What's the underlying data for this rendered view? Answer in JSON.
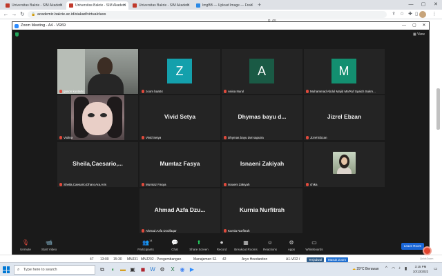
{
  "browser": {
    "tabs": [
      {
        "label": "Universitas Bakrie - SIM Akadem",
        "active": false,
        "favicon_color": "#c0392b"
      },
      {
        "label": "Universitas Bakrie - SIM Akadem",
        "active": true,
        "favicon_color": "#c0392b"
      },
      {
        "label": "Universitas Bakrie - SIM Akadem",
        "active": false,
        "favicon_color": "#c0392b"
      },
      {
        "label": "ImgBB — Upload Image — Free",
        "active": false,
        "favicon_color": "#2b8ae6"
      }
    ],
    "new_tab": "+",
    "url": "academic.bakrie.ac.id/siakad/virtualclass"
  },
  "zoom": {
    "title": "Zoom Meeting - A4 - VR69",
    "view_label": "View",
    "accent_color": "#2d8cff",
    "speaking_color": "#c7e54a",
    "tiles": [
      {
        "name": "guson kuntarto",
        "type": "video",
        "speaking": true
      },
      {
        "name": "zoom baa04",
        "type": "letter",
        "letter": "Z",
        "color": "#14a0ac"
      },
      {
        "name": "Anisa Nurul",
        "type": "letter",
        "letter": "A",
        "color": "#1a5a45"
      },
      {
        "name": "Muhammad Abdul Majid Ma'Ruf Syaich Sukm...",
        "type": "letter",
        "letter": "M",
        "color": "#138f70"
      },
      {
        "name": "Violina",
        "type": "avatar"
      },
      {
        "name": "Vivid Setya",
        "display": "Vivid Setya",
        "type": "name"
      },
      {
        "name": "Dhymas bayu dwi saputra",
        "display": "Dhymas bayu d...",
        "type": "name"
      },
      {
        "name": "Jizrel Ebzan",
        "display": "Jizrel Ebzan",
        "type": "name"
      },
      {
        "name": "Sheila,Caesario,Dhani,Ara,Aris",
        "display": "Sheila,Caesario,...",
        "type": "name"
      },
      {
        "name": "Mumtaz Fasya",
        "display": "Mumtaz Fasya",
        "type": "name"
      },
      {
        "name": "Isnaeni Zakiyah",
        "display": "Isnaeni Zakiyah",
        "type": "name"
      },
      {
        "name": "chika",
        "type": "photo"
      },
      {
        "name": "Ahmad Azfa Dzulfaqar",
        "display": "Ahmad Azfa Dzu...",
        "type": "name"
      },
      {
        "name": "Kurnia Nurfitrah",
        "display": "Kurnia Nurfitrah",
        "type": "name"
      }
    ],
    "controls": {
      "unmute": "Unmute",
      "start_video": "Start Video",
      "participants": "Participants",
      "participant_count": "14",
      "chat": "Chat",
      "share_screen": "Share Screen",
      "record": "Record",
      "breakout_rooms": "Breakout Rooms",
      "reactions": "Reactions",
      "apps": "Apps",
      "whiteboards": "Whiteboards",
      "leave": "Leave Room"
    }
  },
  "background_page": {
    "row": {
      "no": "47",
      "start": "13:00",
      "end": "15:30",
      "code": "MNJ31",
      "course_code": "MNJ202 - Pengembangan",
      "program": "Manajemen S1",
      "num": "42",
      "lecturer": "Aryo Hoedaniton",
      "room": "A1-VR2 /",
      "badge1": "Terjadwal",
      "badge2": "Masuk Zoom"
    },
    "corner_text": "R. 05",
    "quick_zoom": "QuickZoom"
  },
  "taskbar": {
    "search_placeholder": "Type here to search",
    "weather": "29°C  Berawan",
    "time": "3:15 PM",
    "date": "10/13/2022"
  }
}
